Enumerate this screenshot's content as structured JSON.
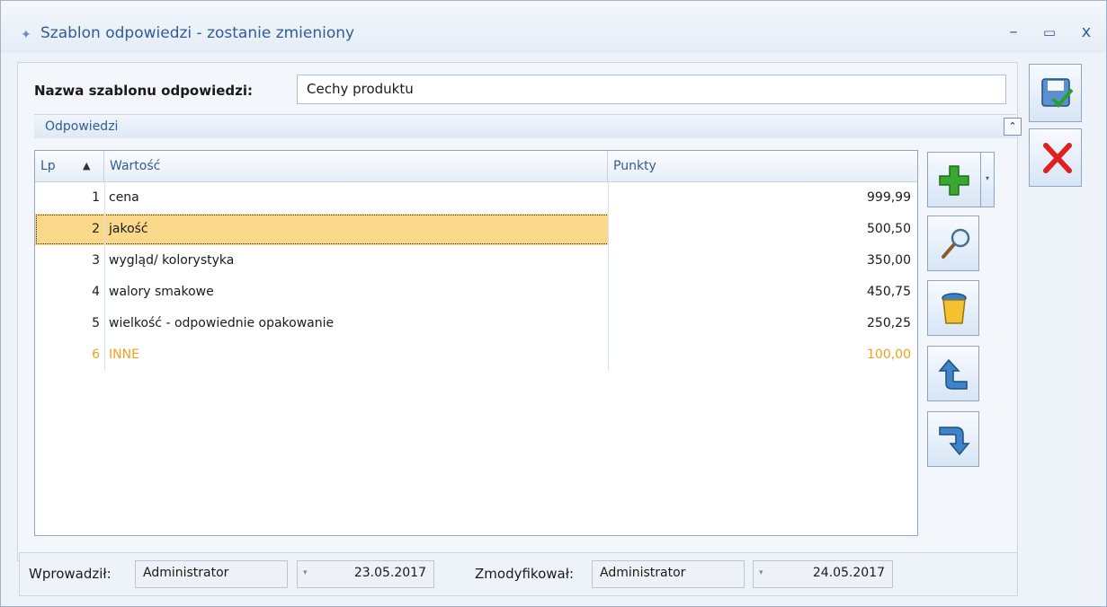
{
  "window": {
    "title": "Szablon odpowiedzi - zostanie zmieniony",
    "minimize": "–",
    "maximize": "▭",
    "close": "x"
  },
  "form": {
    "name_label": "Nazwa szablonu odpowiedzi:",
    "name_value": "Cechy produktu"
  },
  "group": {
    "title": "Odpowiedzi",
    "collapse_glyph": "⌃"
  },
  "grid": {
    "columns": [
      "Lp",
      "Wartość",
      "Punkty"
    ],
    "sort_glyph": "▲",
    "rows": [
      {
        "lp": "1",
        "wartosc": "cena",
        "punkty": "999,99"
      },
      {
        "lp": "2",
        "wartosc": "jakość",
        "punkty": "500,50"
      },
      {
        "lp": "3",
        "wartosc": "wygląd/ kolorystyka",
        "punkty": "350,00"
      },
      {
        "lp": "4",
        "wartosc": "walory smakowe",
        "punkty": "450,75"
      },
      {
        "lp": "5",
        "wartosc": "wielkość - odpowiednie opakowanie",
        "punkty": "250,25"
      },
      {
        "lp": "6",
        "wartosc": "INNE",
        "punkty": "100,00"
      }
    ],
    "selected_row": 2,
    "highlight_color": "#fbd88a",
    "inne_color": "#f0a020"
  },
  "side_toolbar": {
    "icons": [
      "plus-icon",
      "magnifier-icon",
      "trash-icon",
      "arrow-up-icon",
      "arrow-down-icon"
    ],
    "dropdown_glyph": "▾"
  },
  "right_toolbar": {
    "icons": [
      "save-icon",
      "cancel-icon"
    ]
  },
  "footer": {
    "entered_label": "Wprowadził:",
    "entered_by": "Administrator",
    "entered_date": "23.05.2017",
    "modified_label": "Zmodyfikował:",
    "modified_by": "Administrator",
    "modified_date": "24.05.2017",
    "drop_glyph": "▾"
  }
}
